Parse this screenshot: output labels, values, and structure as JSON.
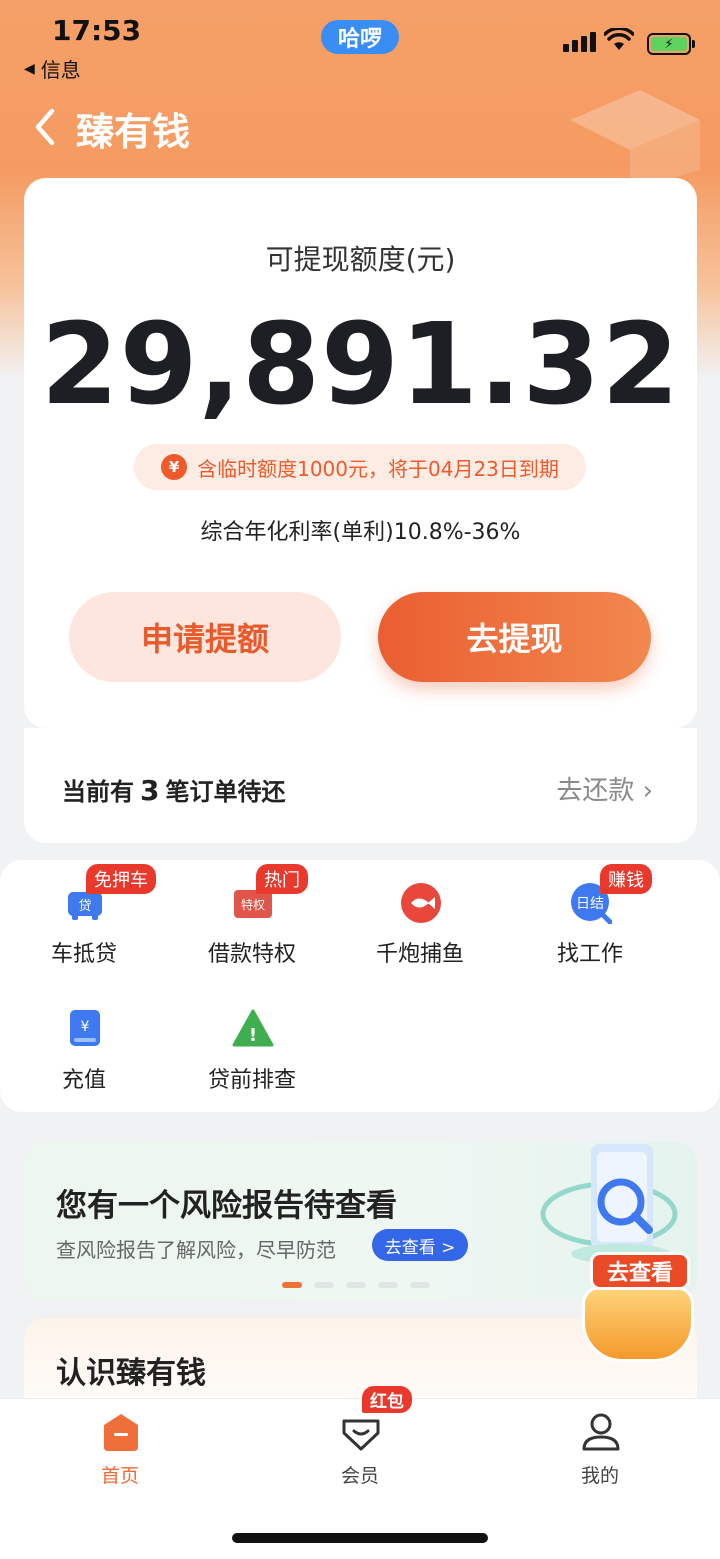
{
  "status_bar": {
    "time": "17:53",
    "back_app": "信息",
    "pill": "哈啰"
  },
  "nav": {
    "title": "臻有钱"
  },
  "quota": {
    "label": "可提现额度(元)",
    "amount": "29,891.32",
    "temp_notice": "含临时额度1000元，将于04月23日到期",
    "temp_icon": "¥",
    "rate": "综合年化利率(单利)10.8%-36%",
    "apply_button": "申请提额",
    "withdraw_button": "去提现"
  },
  "orders": {
    "prefix": "当前有",
    "count": "3",
    "suffix": "笔订单待还",
    "repay_link": "去还款"
  },
  "services": [
    {
      "label": "车抵贷",
      "tag": "免押车",
      "icon": "car-loan-icon",
      "icon_text": "贷"
    },
    {
      "label": "借款特权",
      "tag": "热门",
      "icon": "privilege-icon",
      "icon_text": "特权"
    },
    {
      "label": "千炮捕鱼",
      "tag": "",
      "icon": "fish-icon",
      "icon_text": ""
    },
    {
      "label": "找工作",
      "tag": "赚钱",
      "icon": "job-icon",
      "icon_text": "日结"
    },
    {
      "label": "充值",
      "tag": "",
      "icon": "recharge-icon",
      "icon_text": "¥"
    },
    {
      "label": "贷前排查",
      "tag": "",
      "icon": "warning-icon",
      "icon_text": "!"
    }
  ],
  "banner": {
    "title": "您有一个风险报告待查看",
    "subtitle": "查风险报告了解风险，尽早防范",
    "button": "去查看 >",
    "active_dot": 0,
    "dot_count": 5
  },
  "float_badge": {
    "label": "去查看"
  },
  "know": {
    "title": "认识臻有钱"
  },
  "tabbar": {
    "items": [
      {
        "label": "首页",
        "icon": "home-icon",
        "active": true
      },
      {
        "label": "会员",
        "icon": "member-icon",
        "active": false
      },
      {
        "label": "我的",
        "icon": "profile-icon",
        "active": false
      }
    ],
    "badge": "红包"
  },
  "colors": {
    "accent": "#ee6a36",
    "tag_red": "#e9382c",
    "banner_button": "#3467e8"
  }
}
